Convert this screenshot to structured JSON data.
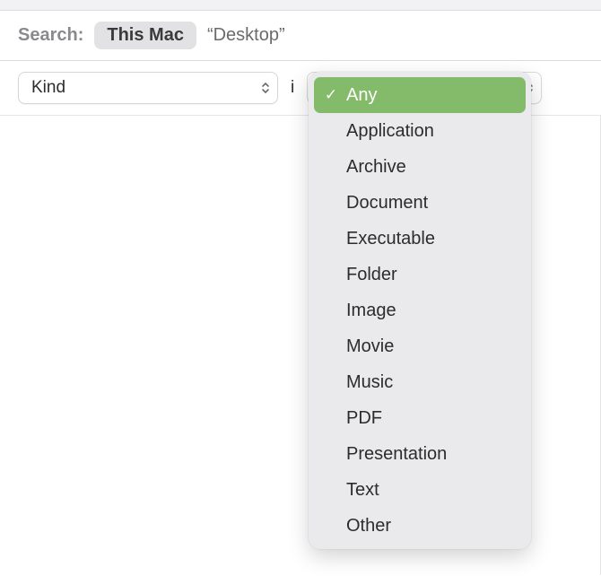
{
  "search": {
    "label": "Search:",
    "scopes": [
      {
        "label": "This Mac",
        "active": true
      },
      {
        "label": "“Desktop”",
        "active": false
      }
    ]
  },
  "criteria": {
    "attribute": {
      "selected": "Kind"
    },
    "connector": "i",
    "value": {
      "selected": "Any",
      "options": [
        "Any",
        "Application",
        "Archive",
        "Document",
        "Executable",
        "Folder",
        "Image",
        "Movie",
        "Music",
        "PDF",
        "Presentation",
        "Text",
        "Other"
      ]
    }
  }
}
